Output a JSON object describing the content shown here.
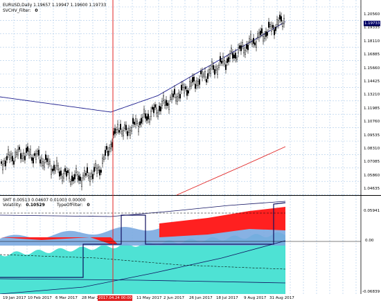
{
  "main_chart": {
    "title": "EURUSD,Daily  1.19657 1.19947 1.19600 1.19733",
    "indicator_label": "SVCHV_Filter:",
    "indicator_value": "0",
    "current_price_tag": "1.19733",
    "price_axis": [
      "1.20560",
      "1.19335",
      "1.18110",
      "1.16885",
      "1.15660",
      "1.14425",
      "1.13210",
      "1.11985",
      "1.10760",
      "1.09535",
      "1.08310",
      "1.07085",
      "1.05860",
      "1.04635"
    ],
    "colors": {
      "candle": "#000000",
      "ma_blue": "#1a1a8c",
      "ma_red": "#e02020",
      "gridline": "#a8c8e8",
      "cursor_line": "#e02020",
      "price_tag_bg": "#000066"
    }
  },
  "sub_chart": {
    "title": "SMT 0.00513 0.04607 0.01003 0.00000",
    "volatility_label": "Volatility:",
    "volatility_value": "0.10529",
    "type_label": "TypeOfFilter:",
    "type_value": "0",
    "value_tag": "0.05941",
    "axis_zero": "0.00",
    "axis_bottom": "-0.06839",
    "colors": {
      "red_fill": "#ff2020",
      "light_blue": "#7aa8e0",
      "cyan": "#40e0d0",
      "navy": "#101060"
    }
  },
  "time_axis": {
    "labels": [
      "19 Jan 2017",
      "10 Feb 2017",
      "6 Mar 2017",
      "28 Mar 2",
      "11 May 2017",
      "2 Jun 2017",
      "26 Jun 2017",
      "18 Jul 2017",
      "9 Aug 2017",
      "31 Aug 2017"
    ],
    "cursor_tag": "2017.04.24 00:00"
  }
}
